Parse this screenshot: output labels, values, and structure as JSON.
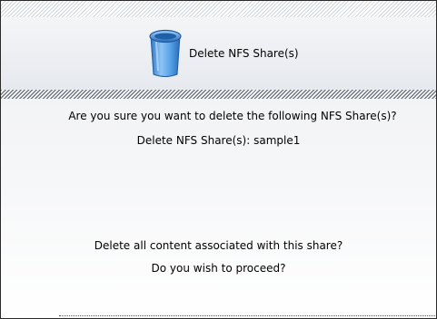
{
  "header": {
    "icon": "trash-can-icon",
    "title": "Delete NFS Share(s)"
  },
  "message": {
    "question": "Are you sure you want to delete the following NFS Share(s)?",
    "share_label": "Delete NFS Share(s):",
    "share_name": "sample1",
    "content_question": "Delete all content associated with this share?",
    "proceed_question": "Do you wish to proceed?"
  },
  "colors": {
    "icon_blue": "#3f8fdc",
    "hatch_dark": "#6f7782",
    "border": "#2a2a2a"
  }
}
